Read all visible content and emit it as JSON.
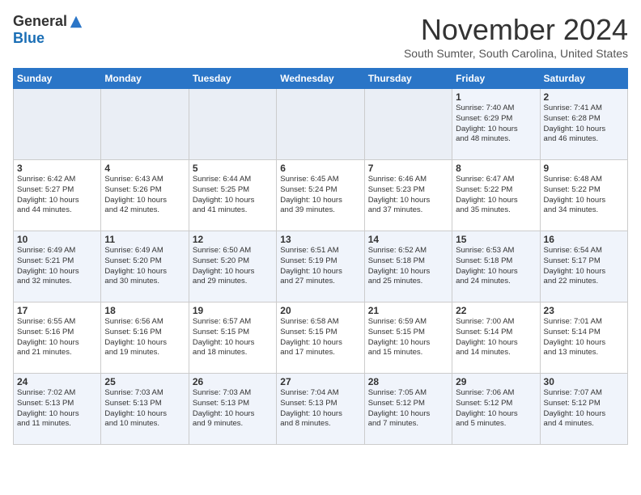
{
  "header": {
    "logo_general": "General",
    "logo_blue": "Blue",
    "month_title": "November 2024",
    "location": "South Sumter, South Carolina, United States"
  },
  "weekdays": [
    "Sunday",
    "Monday",
    "Tuesday",
    "Wednesday",
    "Thursday",
    "Friday",
    "Saturday"
  ],
  "weeks": [
    [
      {
        "day": "",
        "info": ""
      },
      {
        "day": "",
        "info": ""
      },
      {
        "day": "",
        "info": ""
      },
      {
        "day": "",
        "info": ""
      },
      {
        "day": "",
        "info": ""
      },
      {
        "day": "1",
        "info": "Sunrise: 7:40 AM\nSunset: 6:29 PM\nDaylight: 10 hours\nand 48 minutes."
      },
      {
        "day": "2",
        "info": "Sunrise: 7:41 AM\nSunset: 6:28 PM\nDaylight: 10 hours\nand 46 minutes."
      }
    ],
    [
      {
        "day": "3",
        "info": "Sunrise: 6:42 AM\nSunset: 5:27 PM\nDaylight: 10 hours\nand 44 minutes."
      },
      {
        "day": "4",
        "info": "Sunrise: 6:43 AM\nSunset: 5:26 PM\nDaylight: 10 hours\nand 42 minutes."
      },
      {
        "day": "5",
        "info": "Sunrise: 6:44 AM\nSunset: 5:25 PM\nDaylight: 10 hours\nand 41 minutes."
      },
      {
        "day": "6",
        "info": "Sunrise: 6:45 AM\nSunset: 5:24 PM\nDaylight: 10 hours\nand 39 minutes."
      },
      {
        "day": "7",
        "info": "Sunrise: 6:46 AM\nSunset: 5:23 PM\nDaylight: 10 hours\nand 37 minutes."
      },
      {
        "day": "8",
        "info": "Sunrise: 6:47 AM\nSunset: 5:22 PM\nDaylight: 10 hours\nand 35 minutes."
      },
      {
        "day": "9",
        "info": "Sunrise: 6:48 AM\nSunset: 5:22 PM\nDaylight: 10 hours\nand 34 minutes."
      }
    ],
    [
      {
        "day": "10",
        "info": "Sunrise: 6:49 AM\nSunset: 5:21 PM\nDaylight: 10 hours\nand 32 minutes."
      },
      {
        "day": "11",
        "info": "Sunrise: 6:49 AM\nSunset: 5:20 PM\nDaylight: 10 hours\nand 30 minutes."
      },
      {
        "day": "12",
        "info": "Sunrise: 6:50 AM\nSunset: 5:20 PM\nDaylight: 10 hours\nand 29 minutes."
      },
      {
        "day": "13",
        "info": "Sunrise: 6:51 AM\nSunset: 5:19 PM\nDaylight: 10 hours\nand 27 minutes."
      },
      {
        "day": "14",
        "info": "Sunrise: 6:52 AM\nSunset: 5:18 PM\nDaylight: 10 hours\nand 25 minutes."
      },
      {
        "day": "15",
        "info": "Sunrise: 6:53 AM\nSunset: 5:18 PM\nDaylight: 10 hours\nand 24 minutes."
      },
      {
        "day": "16",
        "info": "Sunrise: 6:54 AM\nSunset: 5:17 PM\nDaylight: 10 hours\nand 22 minutes."
      }
    ],
    [
      {
        "day": "17",
        "info": "Sunrise: 6:55 AM\nSunset: 5:16 PM\nDaylight: 10 hours\nand 21 minutes."
      },
      {
        "day": "18",
        "info": "Sunrise: 6:56 AM\nSunset: 5:16 PM\nDaylight: 10 hours\nand 19 minutes."
      },
      {
        "day": "19",
        "info": "Sunrise: 6:57 AM\nSunset: 5:15 PM\nDaylight: 10 hours\nand 18 minutes."
      },
      {
        "day": "20",
        "info": "Sunrise: 6:58 AM\nSunset: 5:15 PM\nDaylight: 10 hours\nand 17 minutes."
      },
      {
        "day": "21",
        "info": "Sunrise: 6:59 AM\nSunset: 5:15 PM\nDaylight: 10 hours\nand 15 minutes."
      },
      {
        "day": "22",
        "info": "Sunrise: 7:00 AM\nSunset: 5:14 PM\nDaylight: 10 hours\nand 14 minutes."
      },
      {
        "day": "23",
        "info": "Sunrise: 7:01 AM\nSunset: 5:14 PM\nDaylight: 10 hours\nand 13 minutes."
      }
    ],
    [
      {
        "day": "24",
        "info": "Sunrise: 7:02 AM\nSunset: 5:13 PM\nDaylight: 10 hours\nand 11 minutes."
      },
      {
        "day": "25",
        "info": "Sunrise: 7:03 AM\nSunset: 5:13 PM\nDaylight: 10 hours\nand 10 minutes."
      },
      {
        "day": "26",
        "info": "Sunrise: 7:03 AM\nSunset: 5:13 PM\nDaylight: 10 hours\nand 9 minutes."
      },
      {
        "day": "27",
        "info": "Sunrise: 7:04 AM\nSunset: 5:13 PM\nDaylight: 10 hours\nand 8 minutes."
      },
      {
        "day": "28",
        "info": "Sunrise: 7:05 AM\nSunset: 5:12 PM\nDaylight: 10 hours\nand 7 minutes."
      },
      {
        "day": "29",
        "info": "Sunrise: 7:06 AM\nSunset: 5:12 PM\nDaylight: 10 hours\nand 5 minutes."
      },
      {
        "day": "30",
        "info": "Sunrise: 7:07 AM\nSunset: 5:12 PM\nDaylight: 10 hours\nand 4 minutes."
      }
    ]
  ]
}
